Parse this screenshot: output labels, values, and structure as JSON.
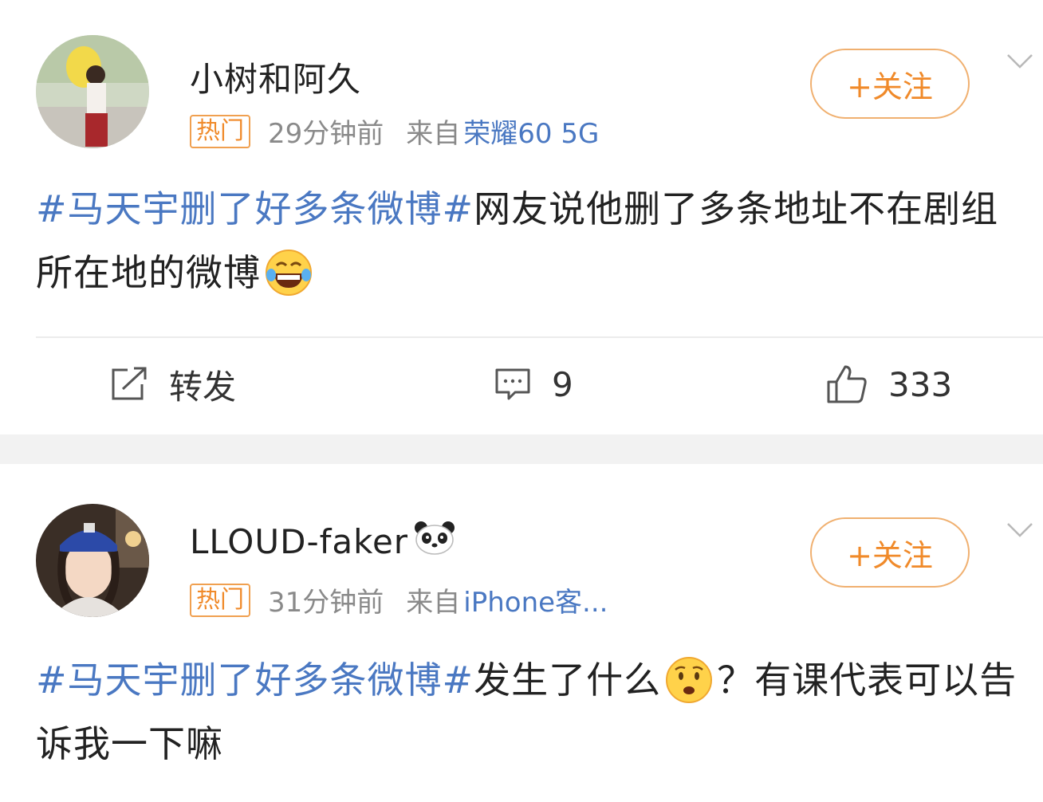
{
  "posts": [
    {
      "username": "小树和阿久",
      "badge": "热门",
      "time": "29分钟前",
      "from_label": "来自",
      "source": "荣耀60 5G",
      "follow_label": "+关注",
      "hashtag": "#马天宇删了好多条微博#",
      "text": "网友说他删了多条地址不在剧组所在地的微博",
      "emoji": "laugh-cry-icon",
      "repost_label": "转发",
      "comment_count": "9",
      "like_count": "333"
    },
    {
      "username": "LLOUD-faker",
      "username_emoji": "panda-icon",
      "badge": "热门",
      "time": "31分钟前",
      "from_label": "来自",
      "source": "iPhone客...",
      "follow_label": "+关注",
      "hashtag": "#马天宇删了好多条微博#",
      "text_before_emoji": "发生了什么",
      "emoji": "worried-face-icon",
      "text_after_emoji": "？有课代表可以告诉我一下嘛"
    }
  ],
  "colors": {
    "hashtag": "#4a78c2",
    "accent_orange": "#f08a2a",
    "meta_gray": "#8a8a8a"
  }
}
